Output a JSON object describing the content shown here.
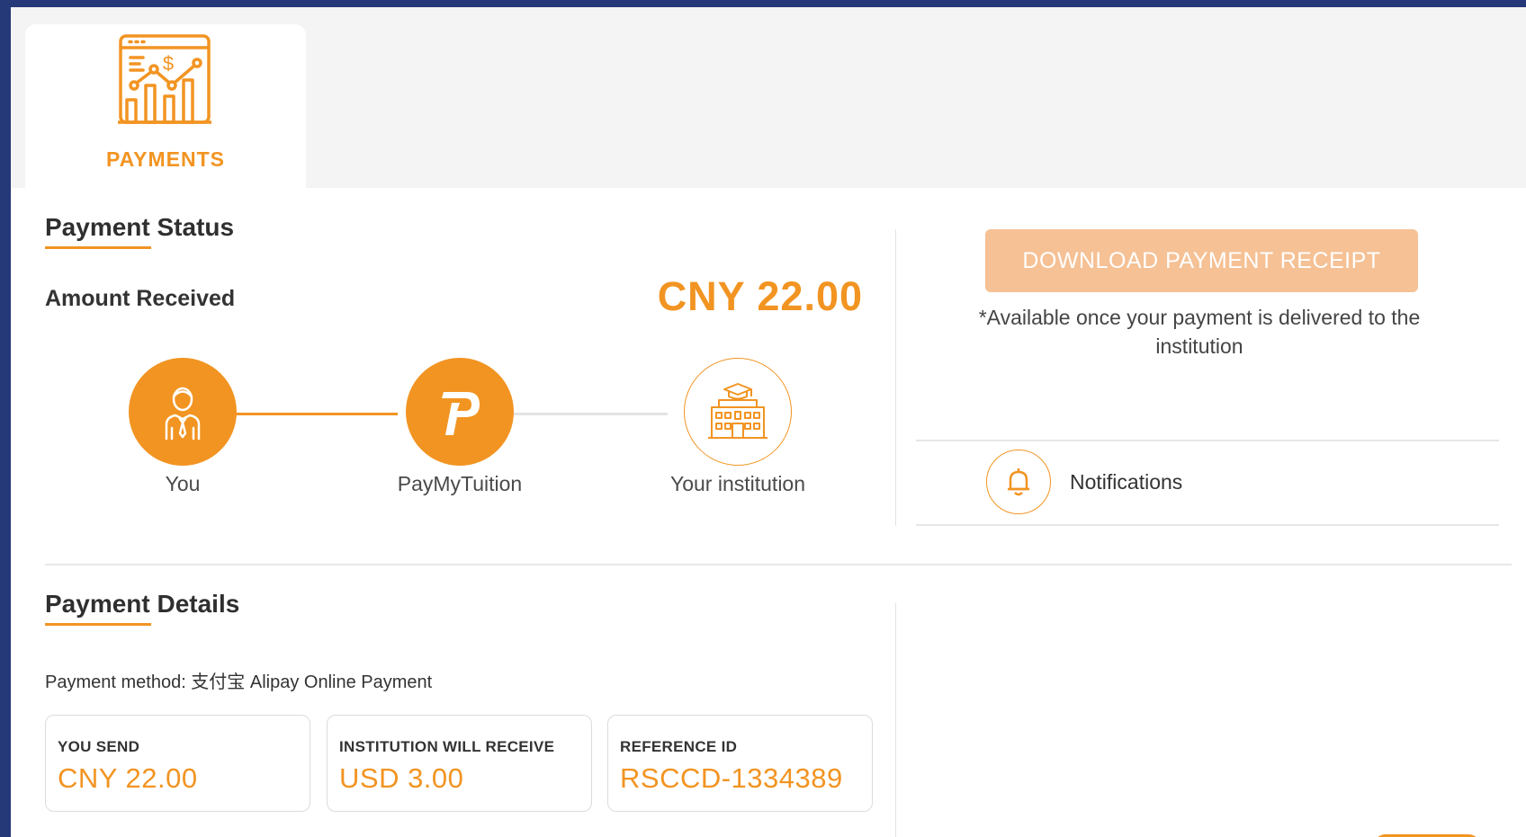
{
  "tab": {
    "label": "PAYMENTS",
    "icon": "analytics-dashboard-icon"
  },
  "status": {
    "title": "Payment Status",
    "amount_label": "Amount Received",
    "amount_value": "CNY 22.00",
    "steps": [
      {
        "label": "You",
        "icon": "person-icon",
        "state": "completed"
      },
      {
        "label": "PayMyTuition",
        "icon": "paymytuition-logo-icon",
        "state": "completed"
      },
      {
        "label": "Your institution",
        "icon": "institution-icon",
        "state": "pending"
      }
    ]
  },
  "receipt": {
    "button_label": "DOWNLOAD PAYMENT RECEIPT",
    "note": "*Available once your payment is delivered to the institution"
  },
  "notifications": {
    "label": "Notifications",
    "icon": "bell-icon"
  },
  "details": {
    "title": "Payment Details",
    "method": "Payment method: 支付宝 Alipay Online Payment",
    "cards": [
      {
        "label": "YOU SEND",
        "value": "CNY 22.00"
      },
      {
        "label": "INSTITUTION WILL RECEIVE",
        "value": "USD 3.00"
      },
      {
        "label": "REFERENCE ID",
        "value": "RSCCD-1334389"
      }
    ]
  },
  "colors": {
    "accent": "#f29422",
    "accent_light": "#f5c195",
    "frame": "#253878"
  }
}
